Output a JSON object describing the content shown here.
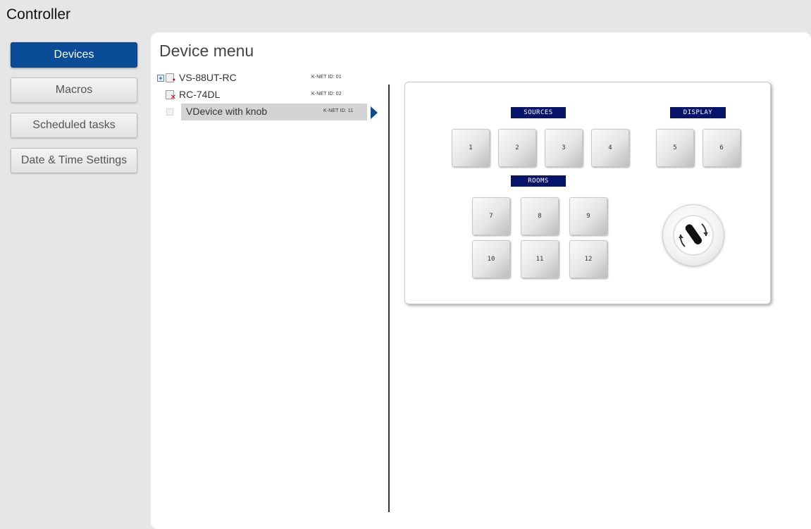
{
  "app": {
    "title": "Controller"
  },
  "sidebar": {
    "items": [
      {
        "label": "Devices",
        "active": true
      },
      {
        "label": "Macros",
        "active": false
      },
      {
        "label": "Scheduled tasks",
        "active": false
      },
      {
        "label": "Date & Time Settings",
        "active": false
      }
    ]
  },
  "main": {
    "title": "Device menu",
    "tree": [
      {
        "name": "VS-88UT-RC",
        "knet": "K-NET ID: 01",
        "icon": "device-icon",
        "expandable": true
      },
      {
        "name": "RC-74DL",
        "knet": "K-NET ID: 02",
        "icon": "device-error-icon",
        "expandable": false
      },
      {
        "name": "VDevice with knob",
        "knet": "K-NET ID: 11",
        "icon": "none",
        "selected": true
      }
    ]
  },
  "device_panel": {
    "sections": {
      "sources": "SOURCES",
      "display": "DISPLAY",
      "rooms": "ROOMS"
    },
    "source_keys": [
      "1",
      "2",
      "3",
      "4"
    ],
    "display_keys": [
      "5",
      "6"
    ],
    "room_keys": [
      "7",
      "8",
      "9",
      "10",
      "11",
      "12"
    ],
    "knob_icon": "rotary-knob-icon"
  },
  "colors": {
    "accent": "#0b4c97",
    "label_bg": "#061569",
    "page_bg": "#e6e6e6"
  }
}
